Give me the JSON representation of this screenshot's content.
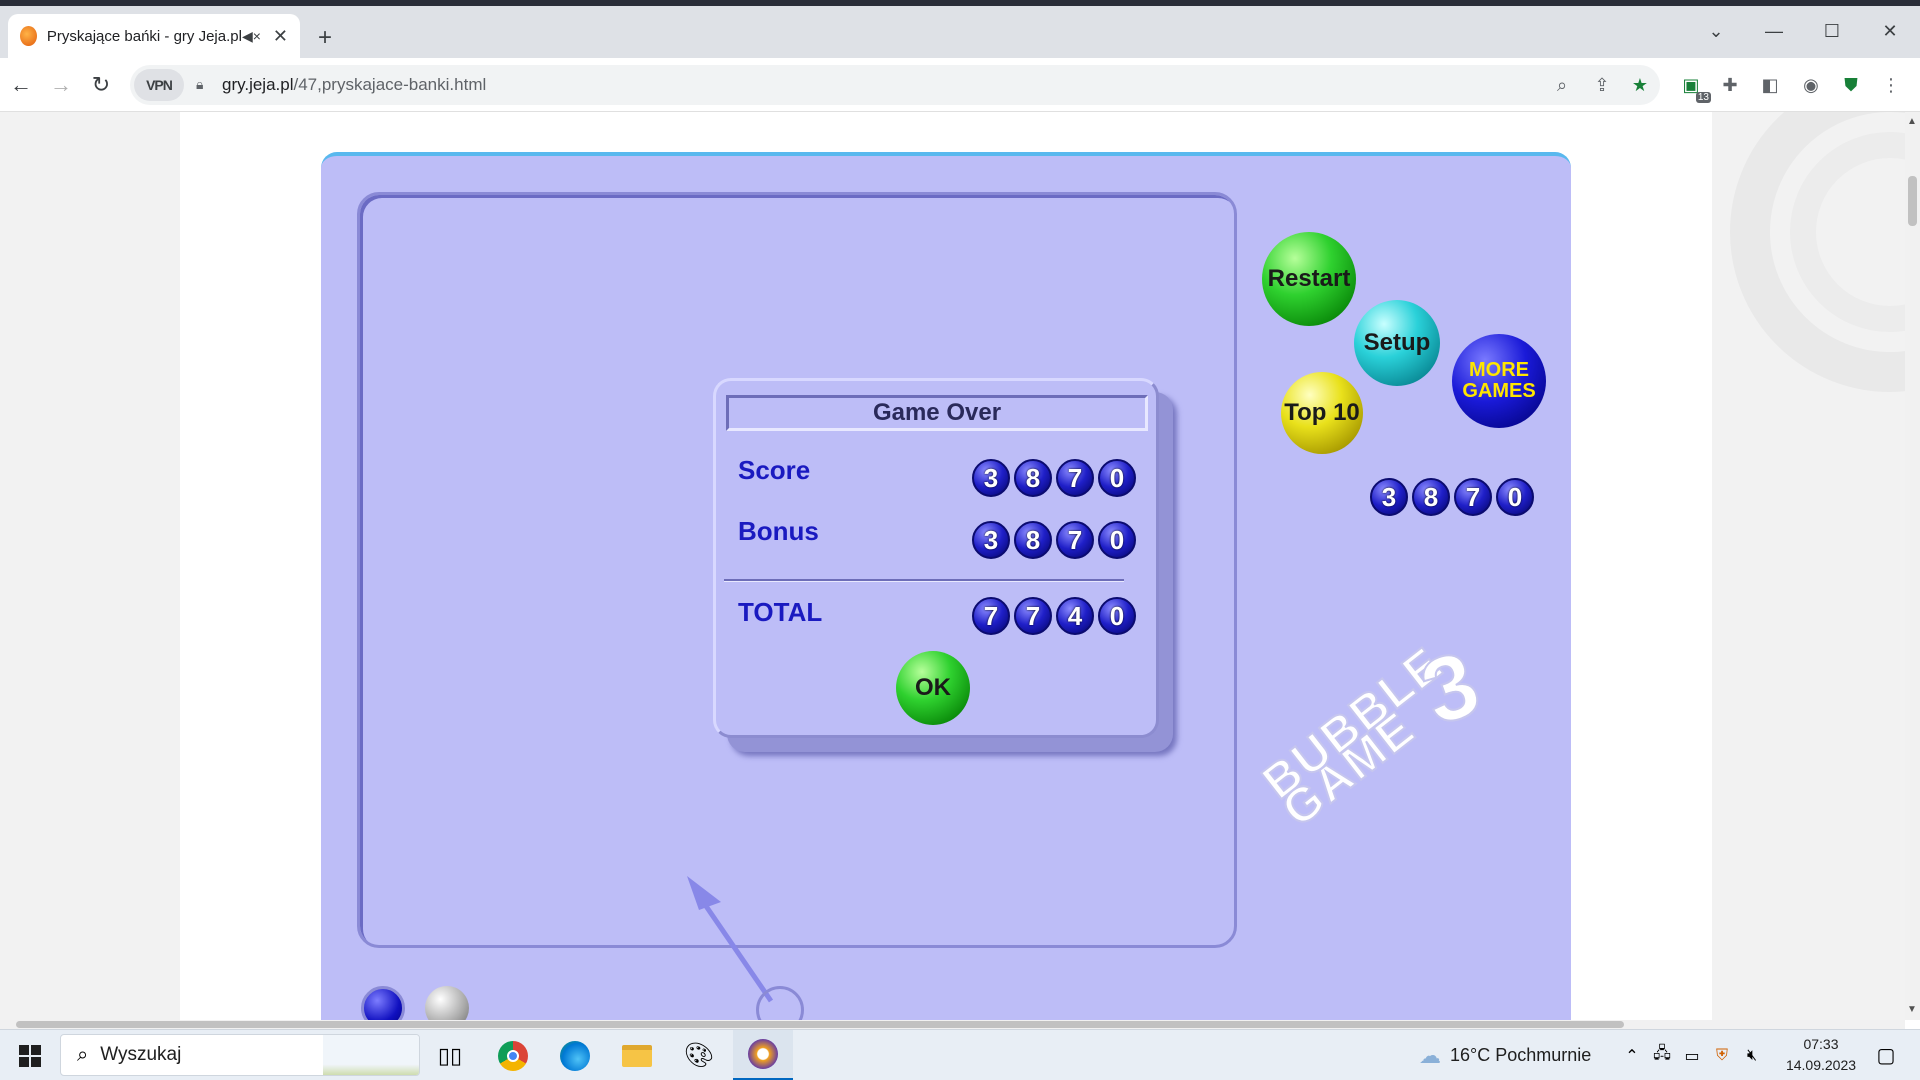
{
  "browser": {
    "tab": {
      "title": "Pryskające bańki - gry Jeja.pl",
      "audio_icon": "speaker-muted-icon",
      "close_icon": "close-icon"
    },
    "new_tab_label": "+",
    "address": {
      "vpn_label": "VPN",
      "host": "gry.jeja.pl",
      "path": "/47,pryskajace-banki.html"
    },
    "extension_badge": "13"
  },
  "game": {
    "buttons": {
      "restart": "Restart",
      "setup": "Setup",
      "top10": "Top 10",
      "more_games_line1": "MORE",
      "more_games_line2": "GAMES",
      "ok": "OK"
    },
    "side_score_digits": [
      "3",
      "8",
      "7",
      "0"
    ],
    "logo_line1": "BUBBLE",
    "logo_line2": "GAME",
    "logo_number": "3",
    "dialog": {
      "title": "Game Over",
      "score_label": "Score",
      "score_digits": [
        "3",
        "8",
        "7",
        "0"
      ],
      "bonus_label": "Bonus",
      "bonus_digits": [
        "3",
        "8",
        "7",
        "0"
      ],
      "total_label": "TOTAL",
      "total_digits": [
        "7",
        "7",
        "4",
        "0"
      ]
    }
  },
  "taskbar": {
    "search_placeholder": "Wyszukaj",
    "weather": "16°C  Pochmurnie",
    "time": "07:33",
    "date": "14.09.2023"
  }
}
